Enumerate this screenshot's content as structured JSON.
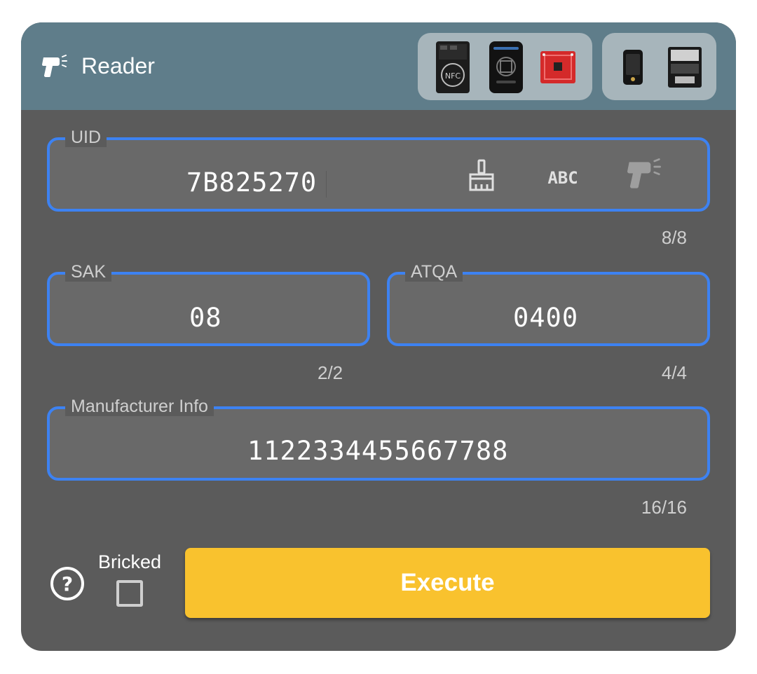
{
  "header": {
    "title": "Reader",
    "icon": "nfc-reader-icon",
    "devices_group_1": [
      "device-nfc-board",
      "device-chameleon-ultra",
      "device-pn532-red-board"
    ],
    "devices_group_2": [
      "device-small-reader",
      "device-keyboard-module"
    ]
  },
  "fields": {
    "uid": {
      "label": "UID",
      "value": "7B825270",
      "counter": "8/8"
    },
    "sak": {
      "label": "SAK",
      "value": "08",
      "counter": "2/2"
    },
    "atqa": {
      "label": "ATQA",
      "value": "0400",
      "counter": "4/4"
    },
    "manufacturer": {
      "label": "Manufacturer Info",
      "value": "1122334455667788",
      "counter": "16/16"
    }
  },
  "uid_actions": [
    "clear-brush-icon",
    "abc-format-icon",
    "read-uid-reader-icon"
  ],
  "footer": {
    "help_icon": "help-circle-icon",
    "bricked_label": "Bricked",
    "bricked_checked": false,
    "execute_label": "Execute"
  },
  "colors": {
    "header_bg": "#5f7d8a",
    "card_bg": "#5b5b5b",
    "field_border": "#3d82f2",
    "execute_bg": "#f9c22e"
  }
}
